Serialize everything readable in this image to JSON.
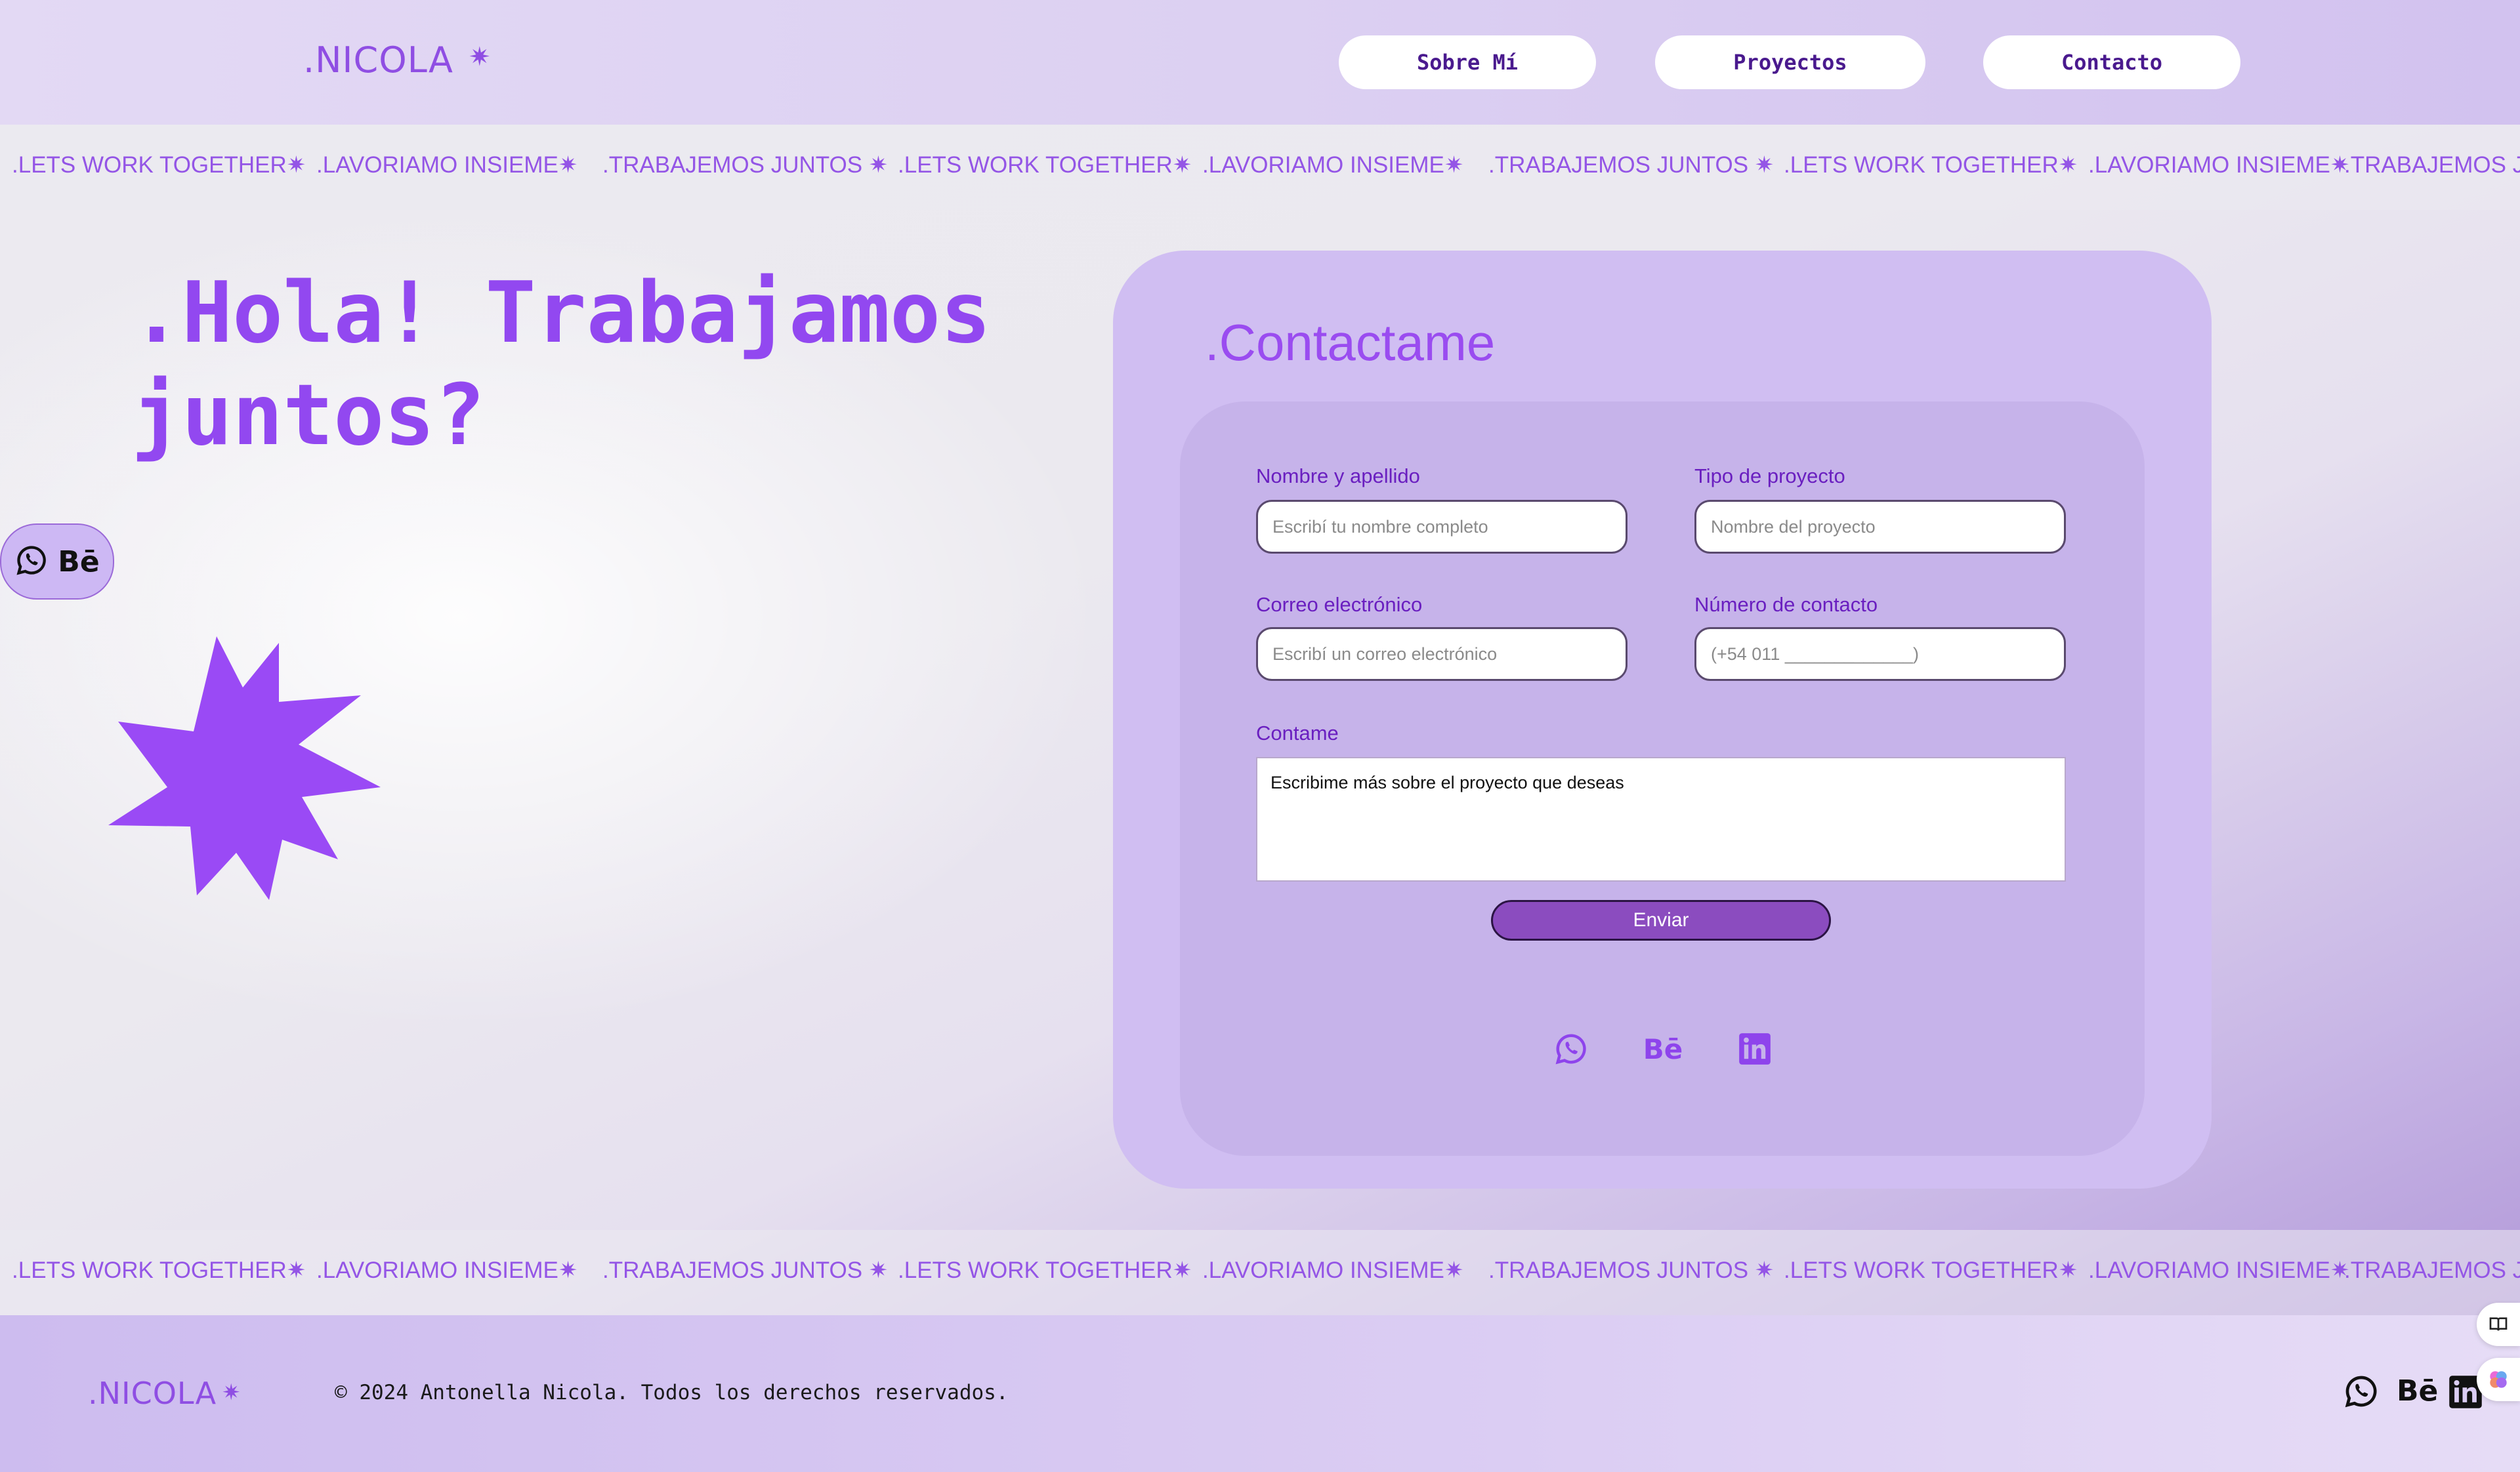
{
  "brand": {
    "logo": ".NICOLA",
    "star": "✷"
  },
  "nav": {
    "items": [
      "Sobre Mí",
      "Proyectos",
      "Contacto"
    ]
  },
  "marquee": {
    "items": [
      ".LETS WORK TOGETHER✷",
      ".LAVORIAMO INSIEME✷",
      ".TRABAJEMOS JUNTOS ✷",
      ".LETS WORK TOGETHER✷",
      ".LAVORIAMO INSIEME✷",
      ".TRABAJEMOS JUNTOS ✷",
      ".LETS WORK TOGETHER✷",
      ".LAVORIAMO INSIEME✷",
      ".TRABAJEMOS JUNTOS"
    ]
  },
  "hero": {
    "title": ".Hola! Trabajamos juntos?"
  },
  "social_pill": {
    "icons": [
      "whatsapp-icon",
      "behance-icon"
    ],
    "behance_text": "Bē"
  },
  "contact": {
    "title": ".Contactame",
    "fields": {
      "name": {
        "label": "Nombre y apellido",
        "placeholder": "Escribí tu nombre completo"
      },
      "project": {
        "label": "Tipo de proyecto",
        "placeholder": "Nombre del proyecto"
      },
      "email": {
        "label": "Correo electrónico",
        "placeholder": "Escribí un correo electrónico"
      },
      "phone": {
        "label": "Número de contacto",
        "placeholder": "(+54 011 _____________)"
      },
      "message": {
        "label": "Contame",
        "value": "Escribime más sobre el proyecto que deseas"
      }
    },
    "submit": "Enviar",
    "socials": [
      "whatsapp-icon",
      "behance-icon",
      "linkedin-icon"
    ],
    "behance_text": "Bē"
  },
  "footer": {
    "logo": ".NICOLA",
    "copyright": "© 2024 Antonella Nicola. Todos los derechos reservados.",
    "behance_text": "Bē"
  },
  "colors": {
    "accent": "#9248f0",
    "card": "#d0bef2",
    "inner": "#c6b3ea",
    "button": "#8b4cbf"
  }
}
